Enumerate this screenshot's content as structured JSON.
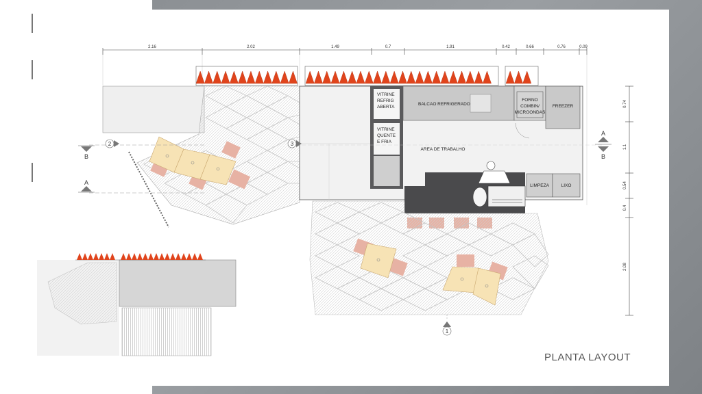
{
  "plan_title": "PLANTA LAYOUT",
  "dimensions_top": [
    "2.16",
    "2.02",
    "1.49",
    "0.7",
    "1.91",
    "0.42",
    "0.66",
    "0.76",
    "0.09"
  ],
  "dimensions_right": [
    "0.74",
    "1.1",
    "0.54",
    "0.4",
    "2.08"
  ],
  "rooms": {
    "vitrine_refrig": [
      "VITRINE",
      "REFRIG",
      "ABERTA"
    ],
    "vitrine_quente": [
      "VITRINE",
      "QUENTE",
      "E FRIA"
    ],
    "balcao": "BALCAO REFRIGERADO",
    "forno": [
      "FORNO",
      "COMBIN/",
      "MICROONDAS"
    ],
    "freezer": "FREEZER",
    "area_trabalho": "AREA DE TRABALHO",
    "limpeza": "LIMPEZA",
    "lixo": "LIXO"
  },
  "section_marks": {
    "a_right": "A",
    "b_right": "B",
    "b_left": "B",
    "a_left": "A",
    "view_2": "2",
    "view_3": "3",
    "view_1": "1"
  },
  "colors": {
    "roof_accent": "#e0441c",
    "table_fill": "#f7e3b5",
    "chair_fill": "#e7b2a4",
    "counter_dark": "#4a4a4c",
    "counter_grey": "#c9c9c9"
  }
}
